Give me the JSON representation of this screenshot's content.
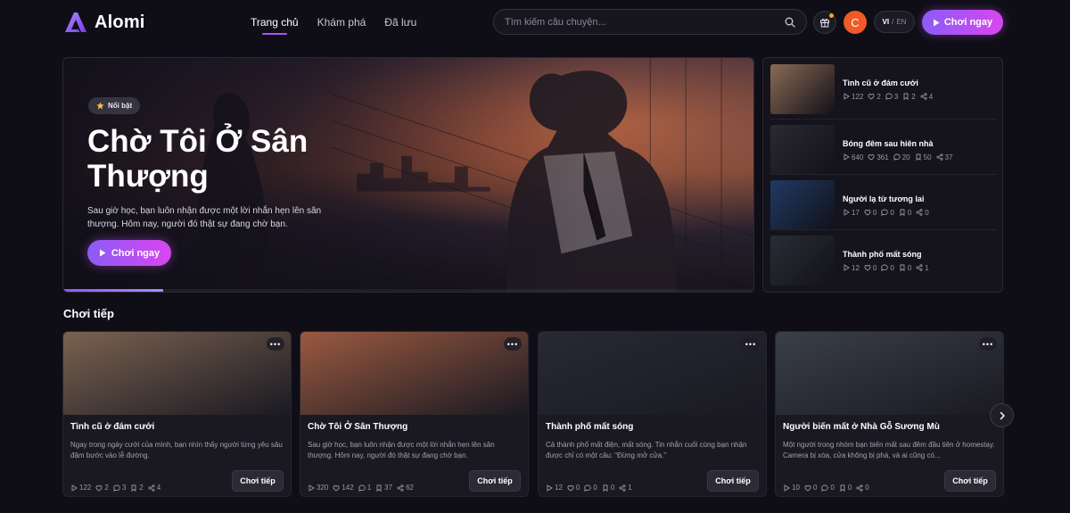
{
  "brand": {
    "name": "Alomi"
  },
  "nav": [
    {
      "label": "Trang chủ",
      "active": true
    },
    {
      "label": "Khám phá",
      "active": false
    },
    {
      "label": "Đã lưu",
      "active": false
    }
  ],
  "search": {
    "placeholder": "Tìm kiếm câu chuyện..."
  },
  "user": {
    "initial": "C"
  },
  "lang": {
    "vi": "VI",
    "sep": "/",
    "en": "EN"
  },
  "header_play_label": "Chơi ngay",
  "hero": {
    "badge": "Nổi bật",
    "title": "Chờ Tôi Ở Sân Thượng",
    "description": "Sau giờ học, bạn luôn nhận được một lời nhắn hẹn lên sân thượng. Hôm nay, người đó thật sự đang chờ bạn.",
    "play_label": "Chơi ngay",
    "progress_fraction": 0.145
  },
  "side_list": [
    {
      "title": "Tình cũ ở đám cưới",
      "stats": [
        "122",
        "2",
        "3",
        "2",
        "4"
      ],
      "color": "#8a6a55"
    },
    {
      "title": "Bóng đêm sau hiên nhà",
      "stats": [
        "640",
        "361",
        "20",
        "50",
        "37"
      ],
      "color": "#2a2a33"
    },
    {
      "title": "Người lạ từ tương lai",
      "stats": [
        "17",
        "0",
        "0",
        "0",
        "0"
      ],
      "color": "#1f3a63"
    },
    {
      "title": "Thành phố mất sóng",
      "stats": [
        "12",
        "0",
        "0",
        "0",
        "1"
      ],
      "color": "#2a2d36"
    }
  ],
  "continue_section": {
    "title": "Chơi tiếp",
    "play_label": "Chơi tiếp",
    "cards": [
      {
        "title": "Tình cũ ở đám cưới",
        "description": "Ngay trong ngày cưới của mình, bạn nhìn thấy người từng yêu sâu đậm bước vào lễ đường.",
        "stats": [
          "122",
          "2",
          "3",
          "2",
          "4"
        ],
        "color": "#7a6250"
      },
      {
        "title": "Chờ Tôi Ở Sân Thượng",
        "description": "Sau giờ học, bạn luôn nhận được một lời nhắn hẹn lên sân thượng. Hôm nay, người đó thật sự đang chờ bạn.",
        "stats": [
          "320",
          "142",
          "1",
          "37",
          "62"
        ],
        "color": "#9a5a40"
      },
      {
        "title": "Thành phố mất sóng",
        "description": "Cả thành phố mất điện, mất sóng. Tin nhắn cuối cùng bạn nhận được chỉ có một câu: “Đừng mở cửa.”",
        "stats": [
          "12",
          "0",
          "0",
          "0",
          "1"
        ],
        "color": "#272a33"
      },
      {
        "title": "Người biến mất ở Nhà Gỗ Sương Mù",
        "description": "Một người trong nhóm bạn biến mất sau đêm đầu tiên ở homestay. Camera bị xóa, cửa không bị phá, và ai cũng có...",
        "stats": [
          "10",
          "0",
          "0",
          "0",
          "0"
        ],
        "color": "#3a3f48"
      }
    ]
  }
}
